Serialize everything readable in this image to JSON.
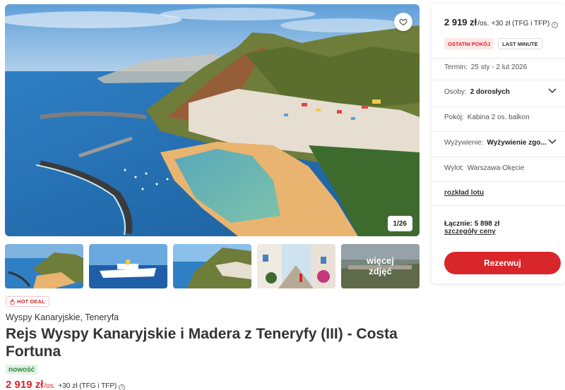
{
  "gallery": {
    "counter": "1/26",
    "more_label": "więcej zdjęć"
  },
  "offer": {
    "hot_deal": "HOT DEAL",
    "location": "Wyspy Kanaryjskie, Teneryfa",
    "title": "Rejs Wyspy Kanaryjskie i Madera z Teneryfy (III) - Costa Fortuna",
    "new_badge": "nowość",
    "price": "2 919 zł",
    "price_unit": "/os.",
    "price_fee": "+30 zł (TFG i TFP)"
  },
  "booking": {
    "price": "2 919 zł",
    "price_unit": "/os.",
    "price_fee": "+30 zł (TFG i TFP)",
    "badge_last_room": "OSTATNI POKÓJ",
    "badge_last_minute": "LAST MINUTE",
    "term_label": "Termin:",
    "term_value": "25 sty - 2 lut 2026",
    "persons_label": "Osoby:",
    "persons_value": "2 dorosłych",
    "room_label": "Pokój:",
    "room_value": "Kabina 2 os. balkon",
    "board_label": "Wyżywienie:",
    "board_value": "Wyżywienie zgo...",
    "departure_label": "Wylot:",
    "departure_value": "Warszawa-Okęcie",
    "flight_schedule_link": "rozkład lotu",
    "total": "Łącznie: 5 898 zł",
    "price_details_link": "szczegóły ceny",
    "book_button": "Rezerwuj"
  },
  "icons": {
    "favorite": "heart-icon",
    "info": "info-icon",
    "chevron": "chevron-down-icon",
    "hot_deal": "flame-icon"
  },
  "colors": {
    "accent": "#d8262b",
    "new_badge_bg": "#e4f3e6",
    "new_badge_text": "#2f8a3c"
  }
}
